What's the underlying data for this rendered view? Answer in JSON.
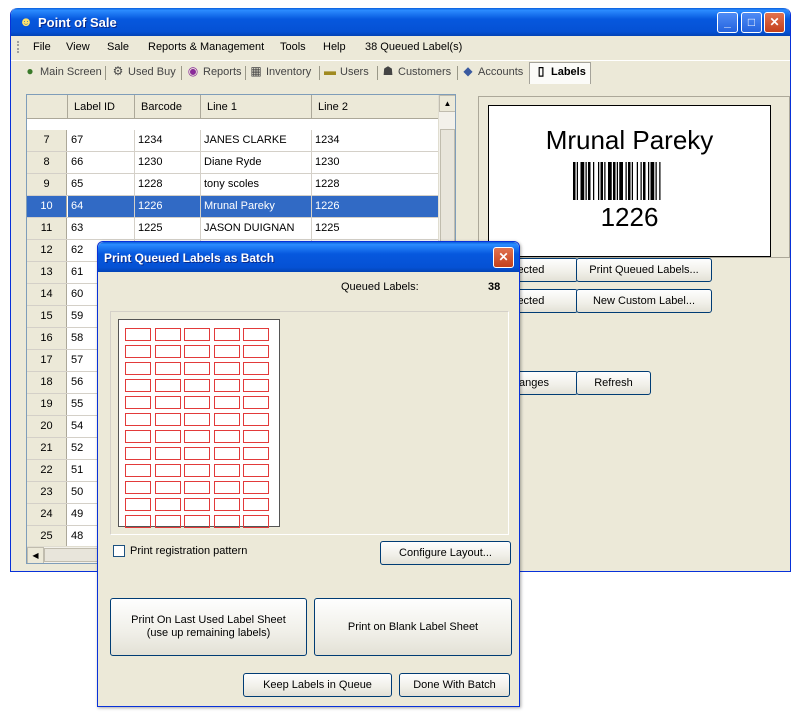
{
  "window": {
    "title": "Point of Sale",
    "minimize": "_",
    "maximize": "□",
    "close": "✕"
  },
  "menu": {
    "items": [
      "File",
      "View",
      "Sale",
      "Reports & Management",
      "Tools",
      "Help"
    ],
    "queued_status": "38 Queued Label(s)"
  },
  "tabs": [
    {
      "label": "Main Screen",
      "icon": "globe-icon"
    },
    {
      "label": "Used Buy",
      "icon": "used-buy-icon"
    },
    {
      "label": "Reports",
      "icon": "reports-icon"
    },
    {
      "label": "Inventory",
      "icon": "inventory-icon"
    },
    {
      "label": "Users",
      "icon": "users-icon"
    },
    {
      "label": "Customers",
      "icon": "customers-icon"
    },
    {
      "label": "Accounts",
      "icon": "accounts-icon"
    },
    {
      "label": "Labels",
      "icon": "labels-icon",
      "active": true
    }
  ],
  "grid": {
    "columns": [
      "Label ID",
      "Barcode",
      "Line 1",
      "Line 2"
    ],
    "rows": [
      {
        "num": "7",
        "id": "67",
        "barcode": "1234",
        "line1": "JANES  CLARKE",
        "line2": "1234"
      },
      {
        "num": "8",
        "id": "66",
        "barcode": "1230",
        "line1": "Diane Ryde",
        "line2": "1230"
      },
      {
        "num": "9",
        "id": "65",
        "barcode": "1228",
        "line1": "tony scoles",
        "line2": "1228"
      },
      {
        "num": "10",
        "id": "64",
        "barcode": "1226",
        "line1": "Mrunal Pareky",
        "line2": "1226",
        "selected": true
      },
      {
        "num": "11",
        "id": "63",
        "barcode": "1225",
        "line1": "JASON DUIGNAN",
        "line2": "1225"
      },
      {
        "num": "12",
        "id": "62",
        "barcode": "",
        "line1": "",
        "line2": ""
      },
      {
        "num": "13",
        "id": "61",
        "barcode": "",
        "line1": "",
        "line2": ""
      },
      {
        "num": "14",
        "id": "60",
        "barcode": "",
        "line1": "",
        "line2": ""
      },
      {
        "num": "15",
        "id": "59",
        "barcode": "",
        "line1": "",
        "line2": ""
      },
      {
        "num": "16",
        "id": "58",
        "barcode": "",
        "line1": "",
        "line2": ""
      },
      {
        "num": "17",
        "id": "57",
        "barcode": "",
        "line1": "",
        "line2": ""
      },
      {
        "num": "18",
        "id": "56",
        "barcode": "",
        "line1": "",
        "line2": ""
      },
      {
        "num": "19",
        "id": "55",
        "barcode": "",
        "line1": "",
        "line2": ""
      },
      {
        "num": "20",
        "id": "54",
        "barcode": "",
        "line1": "",
        "line2": ""
      },
      {
        "num": "21",
        "id": "52",
        "barcode": "",
        "line1": "",
        "line2": ""
      },
      {
        "num": "22",
        "id": "51",
        "barcode": "",
        "line1": "",
        "line2": ""
      },
      {
        "num": "23",
        "id": "50",
        "barcode": "",
        "line1": "",
        "line2": ""
      },
      {
        "num": "24",
        "id": "49",
        "barcode": "",
        "line1": "",
        "line2": ""
      },
      {
        "num": "25",
        "id": "48",
        "barcode": "",
        "line1": "",
        "line2": ""
      }
    ]
  },
  "preview": {
    "name": "Mrunal Pareky",
    "code": "1226"
  },
  "right_buttons": {
    "print_selected": "lected",
    "print_queued": "Print Queued Labels...",
    "delete_selected": "lected",
    "new_custom": "New Custom Label...",
    "save_changes": "anges",
    "refresh": "Refresh"
  },
  "dialog": {
    "title": "Print Queued Labels as Batch",
    "queued_label": "Queued Labels:",
    "queued_count": "38",
    "registration_label": "Print registration pattern",
    "configure": "Configure Layout...",
    "print_last": "Print On Last Used Label Sheet (use up remaining labels)",
    "print_blank": "Print on Blank Label Sheet",
    "keep": "Keep Labels in Queue",
    "done": "Done With Batch"
  },
  "colors": {
    "titlebar": "#0552d7",
    "selection": "#316ac5",
    "label_outline": "#e23a3a"
  }
}
